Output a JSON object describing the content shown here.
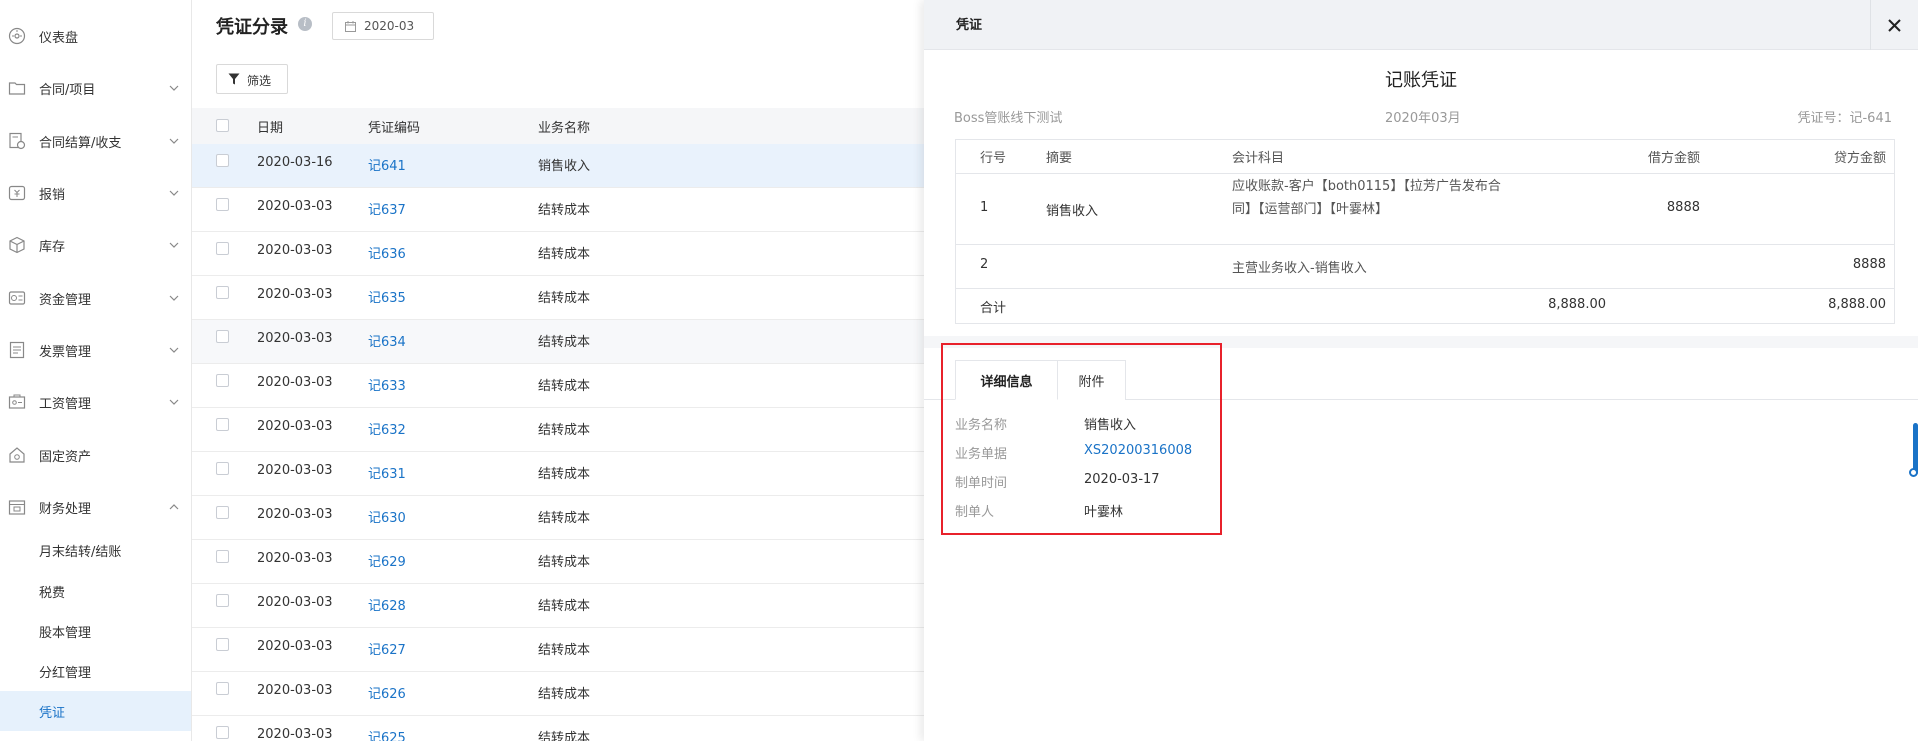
{
  "sidebar": {
    "items": [
      {
        "label": "仪表盘",
        "icon": "dashboard-icon",
        "expandable": false
      },
      {
        "label": "合同/项目",
        "icon": "folder-icon",
        "expandable": true
      },
      {
        "label": "合同结算/收支",
        "icon": "settlement-icon",
        "expandable": true
      },
      {
        "label": "报销",
        "icon": "reimburse-icon",
        "expandable": true
      },
      {
        "label": "库存",
        "icon": "box-icon",
        "expandable": true
      },
      {
        "label": "资金管理",
        "icon": "fund-icon",
        "expandable": true
      },
      {
        "label": "发票管理",
        "icon": "invoice-icon",
        "expandable": true
      },
      {
        "label": "工资管理",
        "icon": "salary-icon",
        "expandable": true
      },
      {
        "label": "固定资产",
        "icon": "asset-icon",
        "expandable": false
      },
      {
        "label": "财务处理",
        "icon": "finance-icon",
        "expandable": true,
        "expanded": true
      }
    ],
    "sub_items": [
      {
        "label": "月末结转/结账"
      },
      {
        "label": "税费"
      },
      {
        "label": "股本管理"
      },
      {
        "label": "分红管理"
      },
      {
        "label": "凭证",
        "active": true
      }
    ]
  },
  "main": {
    "title": "凭证分录",
    "date_value": "2020-03",
    "filter_label": "筛选",
    "columns": [
      "日期",
      "凭证编码",
      "业务名称"
    ],
    "rows": [
      {
        "date": "2020-03-16",
        "code": "记641",
        "name": "销售收入",
        "state": "selected"
      },
      {
        "date": "2020-03-03",
        "code": "记637",
        "name": "结转成本",
        "state": ""
      },
      {
        "date": "2020-03-03",
        "code": "记636",
        "name": "结转成本",
        "state": ""
      },
      {
        "date": "2020-03-03",
        "code": "记635",
        "name": "结转成本",
        "state": ""
      },
      {
        "date": "2020-03-03",
        "code": "记634",
        "name": "结转成本",
        "state": "hover"
      },
      {
        "date": "2020-03-03",
        "code": "记633",
        "name": "结转成本",
        "state": ""
      },
      {
        "date": "2020-03-03",
        "code": "记632",
        "name": "结转成本",
        "state": ""
      },
      {
        "date": "2020-03-03",
        "code": "记631",
        "name": "结转成本",
        "state": ""
      },
      {
        "date": "2020-03-03",
        "code": "记630",
        "name": "结转成本",
        "state": ""
      },
      {
        "date": "2020-03-03",
        "code": "记629",
        "name": "结转成本",
        "state": ""
      },
      {
        "date": "2020-03-03",
        "code": "记628",
        "name": "结转成本",
        "state": ""
      },
      {
        "date": "2020-03-03",
        "code": "记627",
        "name": "结转成本",
        "state": ""
      },
      {
        "date": "2020-03-03",
        "code": "记626",
        "name": "结转成本",
        "state": ""
      },
      {
        "date": "2020-03-03",
        "code": "记625",
        "name": "结转成本",
        "state": ""
      }
    ]
  },
  "drawer": {
    "header_title": "凭证",
    "voucher_title": "记账凭证",
    "company": "Boss管账线下测试",
    "period": "2020年03月",
    "voucher_no": "凭证号：记-641",
    "columns": {
      "line": "行号",
      "summary": "摘要",
      "account": "会计科目",
      "debit": "借方金额",
      "credit": "贷方金额"
    },
    "lines": [
      {
        "line": "1",
        "summary": "销售收入",
        "account": "应收账款-客户【both0115】【拉芳广告发布合同】【运营部门】【叶霎林】",
        "debit": "8888",
        "credit": ""
      },
      {
        "line": "2",
        "summary": "",
        "account": "主营业务收入-销售收入",
        "debit": "",
        "credit": "8888"
      }
    ],
    "total": {
      "label": "合计",
      "debit": "8,888.00",
      "credit": "8,888.00"
    },
    "tabs": [
      "详细信息",
      "附件"
    ],
    "details": [
      {
        "label": "业务名称",
        "value": "销售收入",
        "link": false
      },
      {
        "label": "业务单据",
        "value": "XS20200316008",
        "link": true
      },
      {
        "label": "制单时间",
        "value": "2020-03-17",
        "link": false
      },
      {
        "label": "制单人",
        "value": "叶霎林",
        "link": false
      }
    ]
  },
  "colors": {
    "accent": "#1a73c7",
    "selected_row": "#e9f2fc",
    "highlight_box": "#e8212b"
  }
}
